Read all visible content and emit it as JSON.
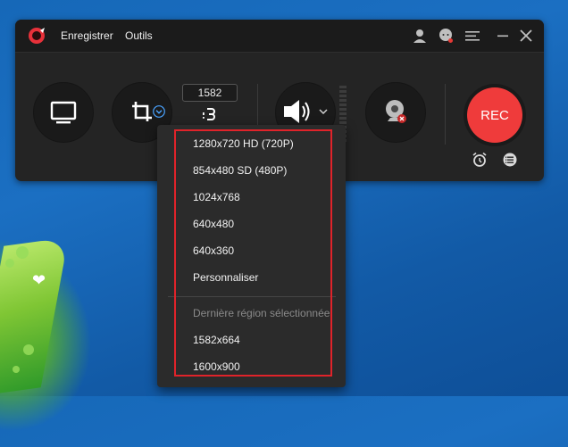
{
  "colors": {
    "rec_button": "#ef3b3b",
    "panel_bg": "#242424",
    "dropdown_bg": "#2b2b2b",
    "highlight_border": "#e0232a",
    "desktop_bg": "#1668b8"
  },
  "titlebar": {
    "menu": [
      "Enregistrer",
      "Outils"
    ],
    "icons": [
      "account-icon",
      "chat-support-icon",
      "menu-icon",
      "minimize-icon",
      "close-icon"
    ]
  },
  "toolbar": {
    "resolution_value": "1582",
    "link_icon": "chain-link-icon",
    "rec_label": "REC"
  },
  "dropdown": {
    "items": [
      "1280x720 HD (720P)",
      "854x480 SD (480P)",
      "1024x768",
      "640x480",
      "640x360",
      "Personnaliser"
    ],
    "recent_header": "Dernière région sélectionnée",
    "recent_items": [
      "1582x664",
      "1600x900"
    ]
  }
}
